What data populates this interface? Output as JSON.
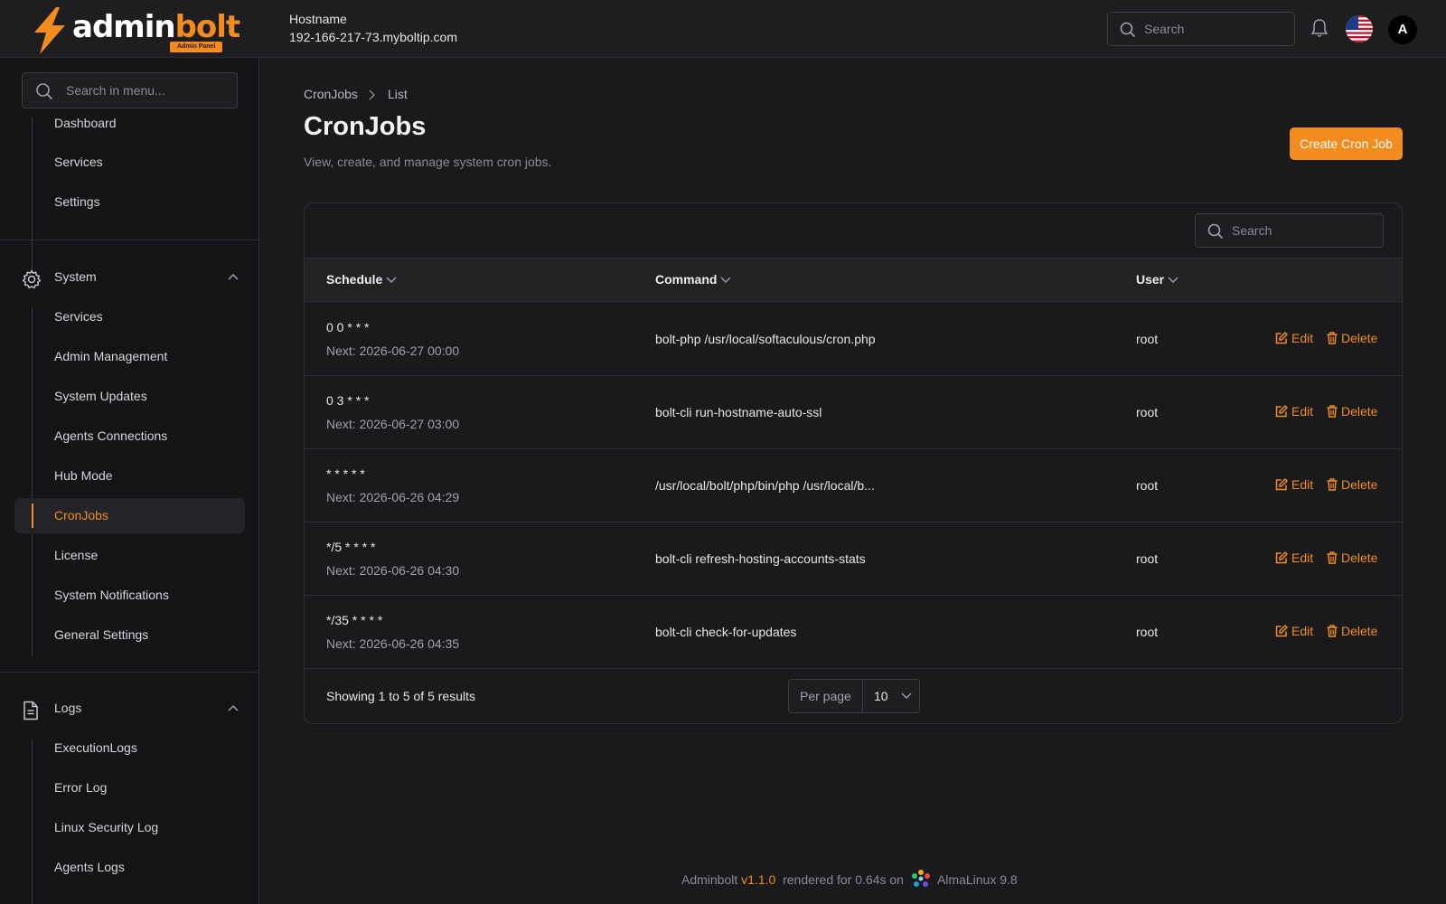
{
  "header": {
    "logo_prefix": "admin",
    "logo_suffix": "bolt",
    "logo_badge": "Admin Panel",
    "hostname_label": "Hostname",
    "hostname_value": "192-166-217-73.myboltip.com",
    "search_placeholder": "Search",
    "avatar_letter": "A"
  },
  "sidebar": {
    "search_placeholder": "Search in menu...",
    "top_items": [
      "Dashboard",
      "Services",
      "Settings"
    ],
    "groups": [
      {
        "label": "System",
        "items": [
          "Services",
          "Admin Management",
          "System Updates",
          "Agents Connections",
          "Hub Mode",
          "CronJobs",
          "License",
          "System Notifications",
          "General Settings"
        ]
      },
      {
        "label": "Logs",
        "items": [
          "ExecutionLogs",
          "Error Log",
          "Linux Security Log",
          "Agents Logs"
        ]
      }
    ],
    "active_item": "CronJobs"
  },
  "page": {
    "breadcrumb": [
      "CronJobs",
      "List"
    ],
    "title": "CronJobs",
    "description": "View, create, and manage system cron jobs.",
    "create_button": "Create Cron Job"
  },
  "table": {
    "search_placeholder": "Search",
    "columns": [
      "Schedule",
      "Command",
      "User"
    ],
    "edit_label": "Edit",
    "delete_label": "Delete",
    "rows": [
      {
        "schedule": "0 0 * * *",
        "next": "Next: 2026-06-27 00:00",
        "command": "bolt-php /usr/local/softaculous/cron.php",
        "user": "root"
      },
      {
        "schedule": "0 3 * * *",
        "next": "Next: 2026-06-27 03:00",
        "command": "bolt-cli run-hostname-auto-ssl",
        "user": "root"
      },
      {
        "schedule": "* * * * *",
        "next": "Next: 2026-06-26 04:29",
        "command": "/usr/local/bolt/php/bin/php /usr/local/b...",
        "user": "root"
      },
      {
        "schedule": "*/5 * * * *",
        "next": "Next: 2026-06-26 04:30",
        "command": "bolt-cli refresh-hosting-accounts-stats",
        "user": "root"
      },
      {
        "schedule": "*/35 * * * *",
        "next": "Next: 2026-06-26 04:35",
        "command": "bolt-cli check-for-updates",
        "user": "root"
      }
    ],
    "showing": "Showing 1 to 5 of 5 results",
    "per_page_label": "Per page",
    "per_page_value": "10"
  },
  "footer": {
    "app": "Adminbolt",
    "version": "v1.1.0",
    "rendered": "rendered for 0.64s on",
    "os": "AlmaLinux 9.8"
  },
  "colors": {
    "accent": "#f28c1e",
    "background": "#1a1a1c",
    "sidebar": "#141416"
  }
}
